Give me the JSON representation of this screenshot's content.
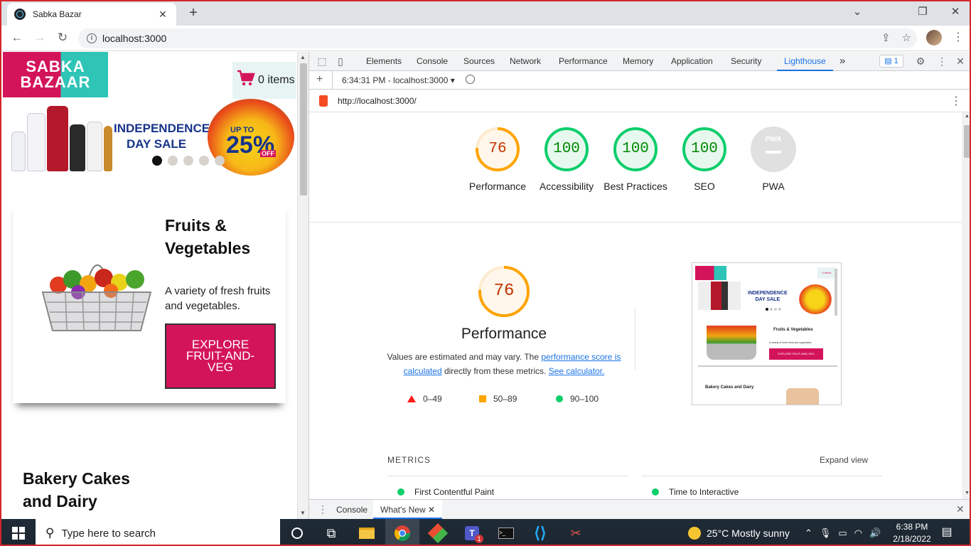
{
  "browser": {
    "tab_title": "Sabka Bazar",
    "tab_close": "✕",
    "new_tab": "+",
    "url": "localhost:3000",
    "window_controls": {
      "minimize": "⌄",
      "restore": "❐",
      "close": "✕"
    }
  },
  "page": {
    "logo_line1": "SABKA",
    "logo_line2": "BAZAAR",
    "cart_label": "0 items",
    "banner": {
      "line1": "INDEPENDENCE",
      "line2": "DAY SALE",
      "up_to": "UP TO",
      "percent": "25%",
      "off": "OFF",
      "slides": 5,
      "active_slide": 1
    },
    "category1": {
      "title": "Fruits & Vegetables",
      "description": "A variety of fresh fruits and vegetables.",
      "button": "EXPLORE FRUIT-AND-VEG"
    },
    "category2": {
      "title": "Bakery Cakes and Dairy"
    }
  },
  "devtools": {
    "tabs": [
      "Elements",
      "Console",
      "Sources",
      "Network",
      "Performance",
      "Memory",
      "Application",
      "Security",
      "Lighthouse"
    ],
    "selected_tab": "Lighthouse",
    "more_tabs": "»",
    "issues_count": "1",
    "report_time": "6:34:31 PM - localhost:3000",
    "audited_url": "http://localhost:3000/",
    "scores": [
      {
        "label": "Performance",
        "value": "76",
        "color": "#ffa400"
      },
      {
        "label": "Accessibility",
        "value": "100",
        "color": "#0cce6b"
      },
      {
        "label": "Best Practices",
        "value": "100",
        "color": "#0cce6b"
      },
      {
        "label": "SEO",
        "value": "100",
        "color": "#0cce6b"
      },
      {
        "label": "PWA",
        "value": "PWA",
        "color": "#cccccc"
      }
    ],
    "performance": {
      "score": "76",
      "title": "Performance",
      "note_prefix": "Values are estimated and may vary. The",
      "note_link1": "performance score is calculated",
      "note_middle": "directly from these metrics.",
      "note_link2": "See calculator.",
      "legend": [
        "0–49",
        "50–89",
        "90–100"
      ]
    },
    "metrics_heading": "METRICS",
    "expand_view": "Expand view",
    "metrics": [
      "First Contentful Paint",
      "Time to Interactive"
    ],
    "screenshot": {
      "cat1_title": "Fruits & Vegetables",
      "cat1_desc": "A variety of fresh fruits and vegetables.",
      "cat1_button": "EXPLORE FRUIT-AND-VEG",
      "cat2_title": "Bakery Cakes and Dairy",
      "cart": "0 items"
    },
    "drawer_tabs": [
      "Console",
      "What's New"
    ],
    "drawer_active": "What's New"
  },
  "taskbar": {
    "search_placeholder": "Type here to search",
    "weather": "25°C  Mostly sunny",
    "time": "6:38 PM",
    "date": "2/18/2022",
    "teams_badge": "1"
  }
}
